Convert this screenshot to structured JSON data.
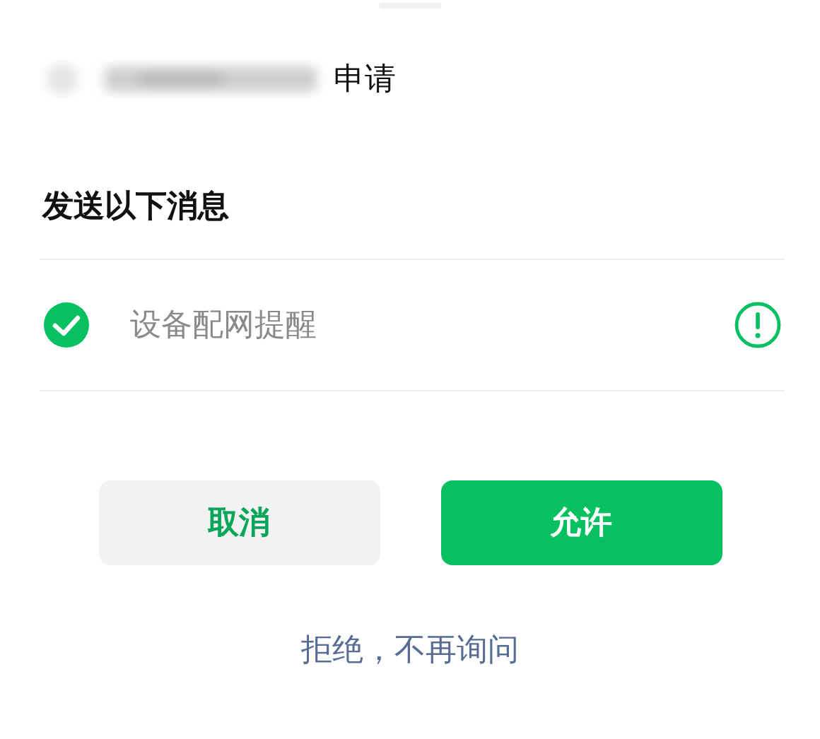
{
  "header": {
    "suffix": "申请"
  },
  "title": "发送以下消息",
  "items": [
    {
      "label": "设备配网提醒",
      "checked": true
    }
  ],
  "buttons": [
    {
      "label": "取消",
      "kind": "secondary"
    },
    {
      "label": "允许",
      "kind": "primary"
    }
  ],
  "link": "拒绝，不再询问"
}
